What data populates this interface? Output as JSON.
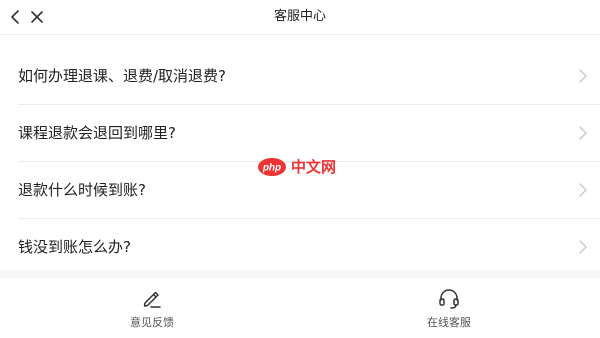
{
  "header": {
    "title": "客服中心",
    "back_icon": "chevron-left-icon",
    "close_icon": "close-icon"
  },
  "faq": {
    "items": [
      {
        "label": "如何办理退课、退费/取消退费?"
      },
      {
        "label": "课程退款会退回到哪里?"
      },
      {
        "label": "退款什么时候到账?"
      },
      {
        "label": "钱没到账怎么办?"
      }
    ]
  },
  "watermark": {
    "logo_text": "php",
    "text": "中文网"
  },
  "footer": {
    "feedback_label": "意见反馈",
    "feedback_icon": "pencil-icon",
    "service_label": "在线客服",
    "service_icon": "headset-icon"
  },
  "colors": {
    "text": "#222222",
    "divider": "#ececec",
    "chevron": "#c8c8c8",
    "footer_label": "#555555"
  }
}
